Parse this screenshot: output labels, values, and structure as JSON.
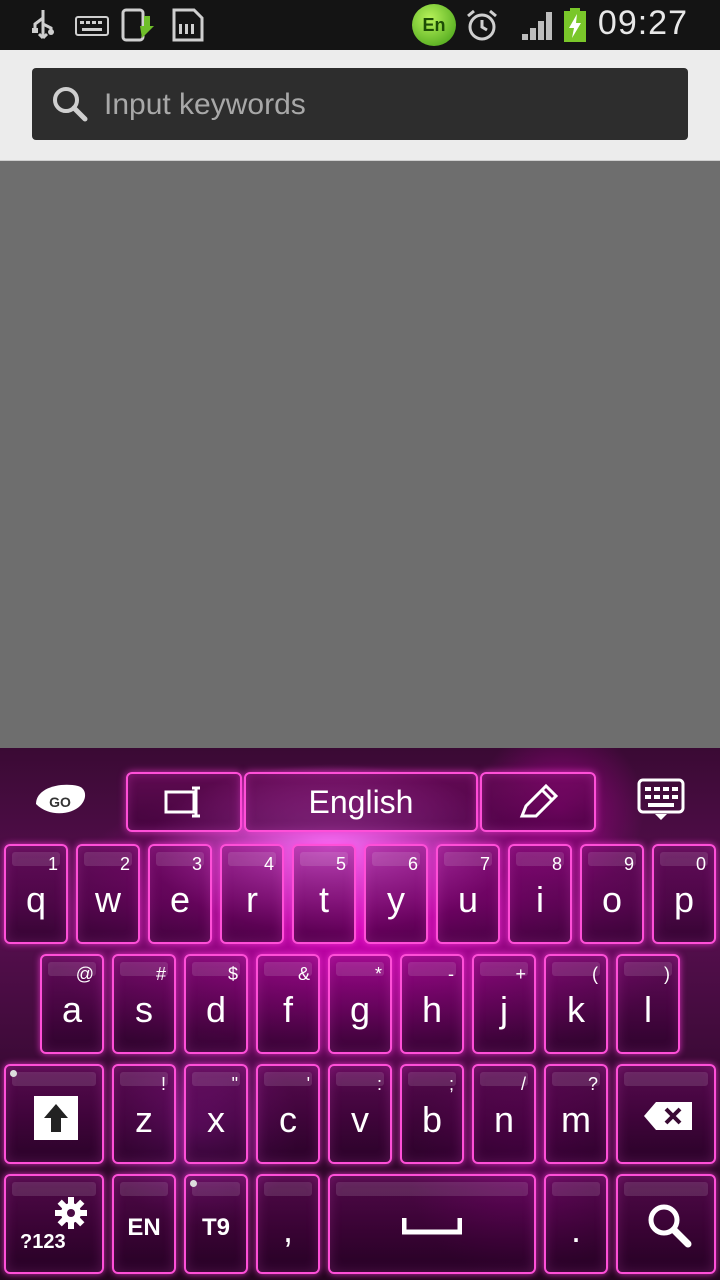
{
  "status_bar": {
    "time": "09:27",
    "icons": [
      "usb-icon",
      "keyboard-icon",
      "phone-upload-icon",
      "sd-card-icon",
      "go-keyboard-en-icon",
      "alarm-icon",
      "signal-icon",
      "battery-charging-icon"
    ],
    "en_badge": "En"
  },
  "search": {
    "placeholder": "Input keywords",
    "value": ""
  },
  "keyboard_toolbar": {
    "logo": "GO",
    "language": "English"
  },
  "keyboard": {
    "row1": [
      {
        "main": "q",
        "sub": "1"
      },
      {
        "main": "w",
        "sub": "2"
      },
      {
        "main": "e",
        "sub": "3"
      },
      {
        "main": "r",
        "sub": "4"
      },
      {
        "main": "t",
        "sub": "5"
      },
      {
        "main": "y",
        "sub": "6"
      },
      {
        "main": "u",
        "sub": "7"
      },
      {
        "main": "i",
        "sub": "8"
      },
      {
        "main": "o",
        "sub": "9"
      },
      {
        "main": "p",
        "sub": "0"
      }
    ],
    "row2": [
      {
        "main": "a",
        "sub": "@"
      },
      {
        "main": "s",
        "sub": "#"
      },
      {
        "main": "d",
        "sub": "$"
      },
      {
        "main": "f",
        "sub": "&"
      },
      {
        "main": "g",
        "sub": "*"
      },
      {
        "main": "h",
        "sub": "-"
      },
      {
        "main": "j",
        "sub": "+"
      },
      {
        "main": "k",
        "sub": "("
      },
      {
        "main": "l",
        "sub": ")"
      }
    ],
    "row3": [
      {
        "main": "z",
        "sub": "!"
      },
      {
        "main": "x",
        "sub": "\""
      },
      {
        "main": "c",
        "sub": "'"
      },
      {
        "main": "v",
        "sub": ":"
      },
      {
        "main": "b",
        "sub": ";"
      },
      {
        "main": "n",
        "sub": "/"
      },
      {
        "main": "m",
        "sub": "?"
      }
    ],
    "symbols_label": "?123",
    "en_label": "EN",
    "t9_label": "T9",
    "comma_label": ",",
    "period_label": "."
  }
}
